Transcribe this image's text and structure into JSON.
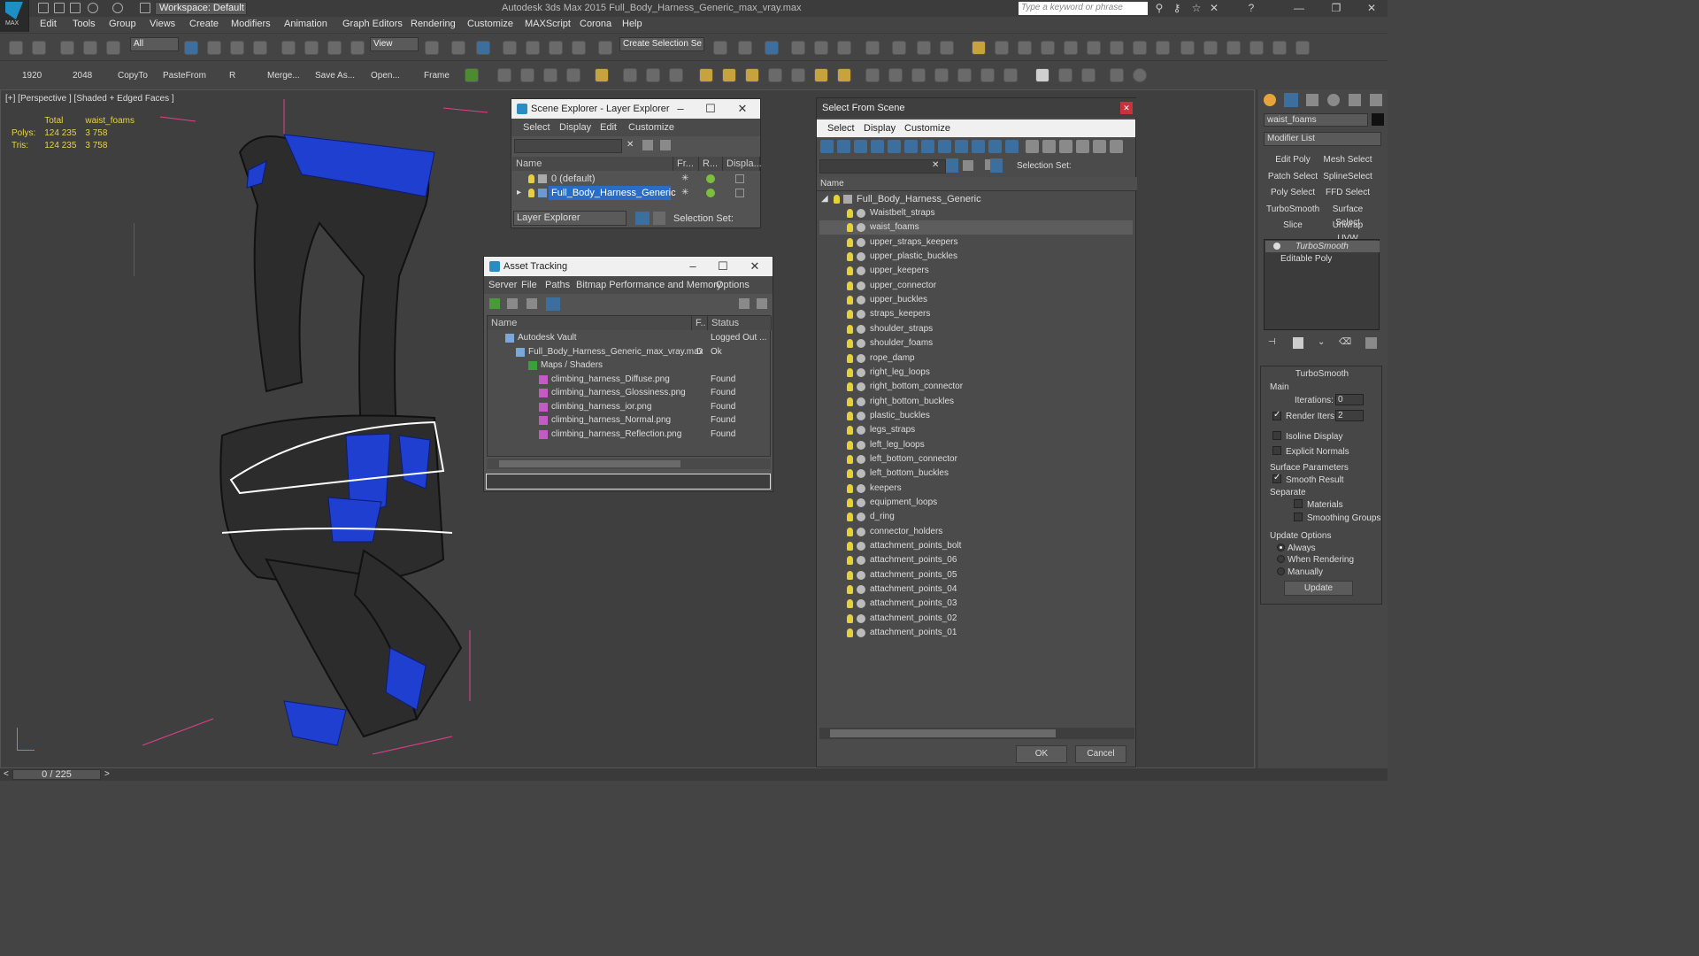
{
  "app": {
    "logo": "MAX",
    "workspace": "Workspace: Default",
    "title": "Autodesk 3ds Max 2015    Full_Body_Harness_Generic_max_vray.max",
    "search_placeholder": "Type a keyword or phrase"
  },
  "menu": [
    "Edit",
    "Tools",
    "Group",
    "Views",
    "Create",
    "Modifiers",
    "Animation",
    "Graph Editors",
    "Rendering",
    "Customize",
    "MAXScript",
    "Corona",
    "Help"
  ],
  "toolbar1": {
    "filter": "All",
    "view": "View",
    "selection_set": "Create Selection Se"
  },
  "toolbar2": {
    "labels": [
      "1920",
      "2048",
      "CopyTo",
      "PasteFrom",
      "R",
      "Merge...",
      "Save As...",
      "Open...",
      "Frame"
    ]
  },
  "viewport": {
    "label": "[+] [Perspective ] [Shaded + Edged Faces ]",
    "stats": {
      "col_total": "Total",
      "col_obj": "waist_foams",
      "polys_label": "Polys:",
      "polys_total": "124 235",
      "polys_obj": "3 758",
      "tris_label": "Tris:",
      "tris_total": "124 235",
      "tris_obj": "3 758"
    }
  },
  "scene_explorer": {
    "title": "Scene Explorer - Layer Explorer",
    "menu": [
      "Select",
      "Display",
      "Edit",
      "Customize"
    ],
    "columns": [
      "Name",
      "Fr...",
      "R...",
      "Displa..."
    ],
    "rows": [
      "0 (default)",
      "Full_Body_Harness_Generic"
    ],
    "footer_dropdown": "Layer Explorer",
    "footer_label": "Selection Set:"
  },
  "asset_tracking": {
    "title": "Asset Tracking",
    "menu": [
      "Server",
      "File",
      "Paths",
      "Bitmap Performance and Memory",
      "Options"
    ],
    "columns": [
      "Name",
      "F..",
      "Status"
    ],
    "rows": [
      {
        "name": "Autodesk Vault",
        "f": "",
        "status": "Logged Out ..."
      },
      {
        "name": "Full_Body_Harness_Generic_max_vray.max",
        "f": "D",
        "status": "Ok"
      },
      {
        "name": "Maps / Shaders",
        "f": "",
        "status": ""
      },
      {
        "name": "climbing_harness_Diffuse.png",
        "f": "",
        "status": "Found"
      },
      {
        "name": "climbing_harness_Glossiness.png",
        "f": "",
        "status": "Found"
      },
      {
        "name": "climbing_harness_ior.png",
        "f": "",
        "status": "Found"
      },
      {
        "name": "climbing_harness_Normal.png",
        "f": "",
        "status": "Found"
      },
      {
        "name": "climbing_harness_Reflection.png",
        "f": "",
        "status": "Found"
      }
    ]
  },
  "select_from_scene": {
    "title": "Select From Scene",
    "menu": [
      "Select",
      "Display",
      "Customize"
    ],
    "selection_set_label": "Selection Set:",
    "column": "Name",
    "root": "Full_Body_Harness_Generic",
    "items": [
      "Waistbelt_straps",
      "waist_foams",
      "upper_straps_keepers",
      "upper_plastic_buckles",
      "upper_keepers",
      "upper_connector",
      "upper_buckles",
      "straps_keepers",
      "shoulder_straps",
      "shoulder_foams",
      "rope_damp",
      "right_leg_loops",
      "right_bottom_connector",
      "right_bottom_buckles",
      "plastic_buckles",
      "legs_straps",
      "left_leg_loops",
      "left_bottom_connector",
      "left_bottom_buckles",
      "keepers",
      "equipment_loops",
      "d_ring",
      "connector_holders",
      "attachment_points_bolt",
      "attachment_points_06",
      "attachment_points_05",
      "attachment_points_04",
      "attachment_points_03",
      "attachment_points_02",
      "attachment_points_01"
    ],
    "selected_index": 1,
    "ok": "OK",
    "cancel": "Cancel"
  },
  "command_panel": {
    "object_name": "waist_foams",
    "modifier_list": "Modifier List",
    "buttons": [
      "Edit Poly",
      "Mesh Select",
      "Patch Select",
      "SplineSelect",
      "Poly Select",
      "FFD Select",
      "TurboSmooth",
      "Surface Select",
      "Slice",
      "Unwrap UVW"
    ],
    "stack": [
      "TurboSmooth",
      "Editable Poly"
    ],
    "rollout_title": "TurboSmooth",
    "main_label": "Main",
    "iterations_label": "Iterations:",
    "iterations_value": "0",
    "render_iters_label": "Render Iters:",
    "render_iters_value": "2",
    "isoline": "Isoline Display",
    "explicit_normals": "Explicit Normals",
    "surface_params": "Surface Parameters",
    "smooth_result": "Smooth Result",
    "separate": "Separate",
    "materials": "Materials",
    "smoothing_groups": "Smoothing Groups",
    "update_options": "Update Options",
    "always": "Always",
    "when_rendering": "When Rendering",
    "manually": "Manually",
    "update_btn": "Update"
  },
  "status": {
    "frame": "0 / 225"
  },
  "colors": {
    "accent_blue": "#1f3fd0",
    "stats_yellow": "#e8d24a",
    "selection_highlight": "#2b6cc4"
  }
}
